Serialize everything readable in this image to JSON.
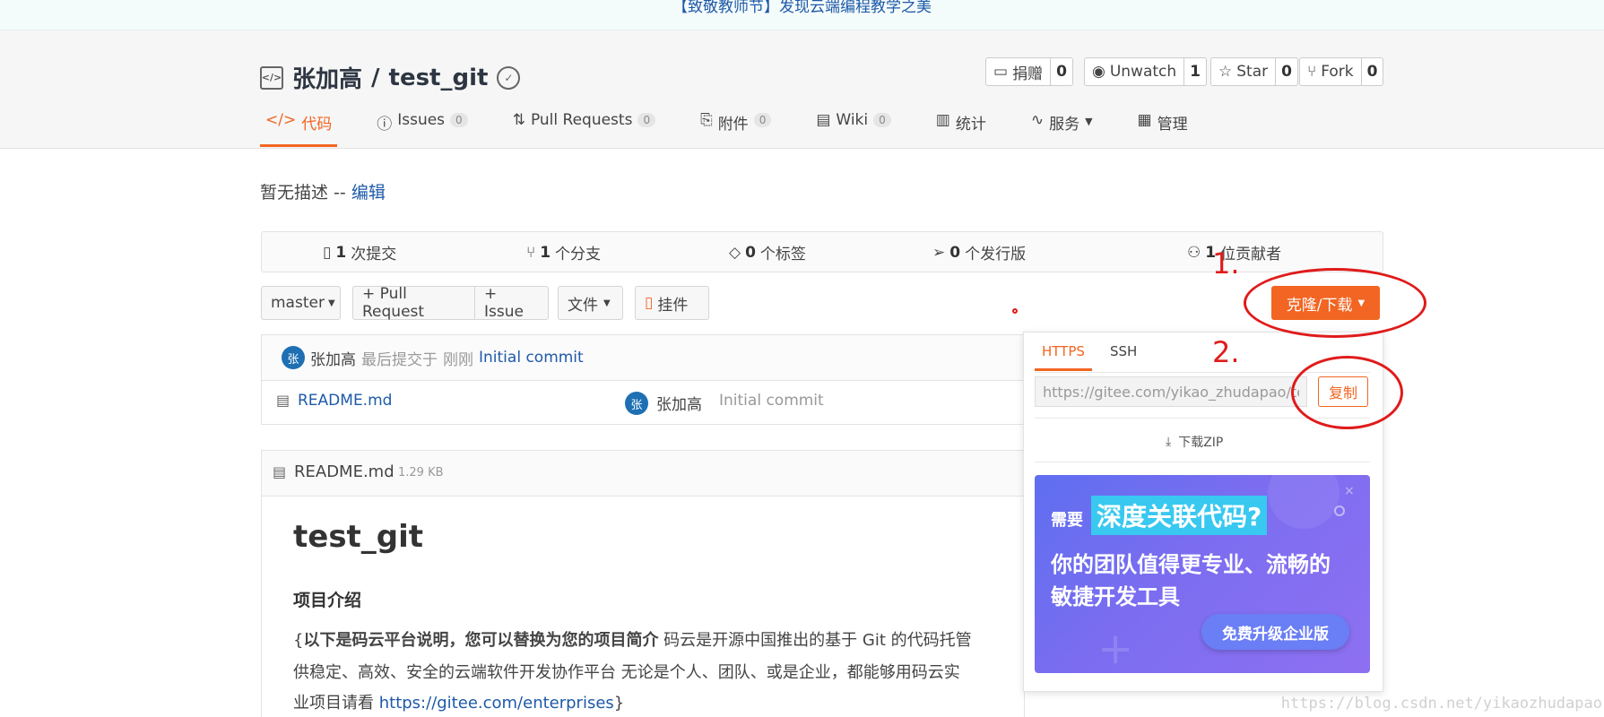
{
  "banner": {
    "text": "【致敬教师节】发现云端编程教学之美"
  },
  "repo": {
    "owner": "张加高",
    "separator": "/",
    "name": "test_git"
  },
  "actions": [
    {
      "label": "捐赠",
      "count": "0",
      "icon": "donate-icon"
    },
    {
      "label": "Unwatch",
      "count": "1",
      "icon": "eye-icon"
    },
    {
      "label": "Star",
      "count": "0",
      "icon": "star-icon"
    },
    {
      "label": "Fork",
      "count": "0",
      "icon": "fork-icon"
    }
  ],
  "tabs": [
    {
      "label": "代码",
      "icon": "code-icon"
    },
    {
      "label": "Issues",
      "count": "0",
      "icon": "issue-icon"
    },
    {
      "label": "Pull Requests",
      "count": "0",
      "icon": "pull-request-icon"
    },
    {
      "label": "附件",
      "count": "0",
      "icon": "attachment-icon"
    },
    {
      "label": "Wiki",
      "count": "0",
      "icon": "book-icon"
    },
    {
      "label": "统计",
      "icon": "chart-icon"
    },
    {
      "label": "服务",
      "icon": "pulse-icon"
    },
    {
      "label": "管理",
      "icon": "settings-doc-icon"
    }
  ],
  "description": {
    "text": "暂无描述 --",
    "edit_link": "编辑"
  },
  "stats": [
    {
      "num": "1",
      "label": "次提交"
    },
    {
      "num": "1",
      "label": "个分支"
    },
    {
      "num": "0",
      "label": "个标签"
    },
    {
      "num": "0",
      "label": "个发行版"
    },
    {
      "num": "1",
      "label": "位贡献者"
    }
  ],
  "toolbar": {
    "branch": "master",
    "pull_request": "+ Pull Request",
    "issue": "+ Issue",
    "file": "文件",
    "widget": "挂件",
    "clone": "克隆/下载"
  },
  "commit": {
    "avatar_char": "张",
    "author": "张加高",
    "meta": "最后提交于",
    "time": "刚刚",
    "message": "Initial commit"
  },
  "files": [
    {
      "name": "README.md",
      "author": "张加高",
      "avatar_char": "张",
      "message": "Initial commit"
    }
  ],
  "readme": {
    "filename": "README.md",
    "size": "1.29 KB",
    "title": "test_git",
    "section": "项目介绍",
    "line1_prefix": "{",
    "line1_bold": "以下是码云平台说明，您可以替换为您的项目简介",
    "line1_rest": " 码云是开源中国推出的基于 Git 的代码托管",
    "line2": "供稳定、高效、安全的云端软件开发协作平台 无论是个人、团队、或是企业，都能够用码云实",
    "line3_prefix": "业项目请看 ",
    "line3_link": "https://gitee.com/enterprises",
    "line3_suffix": "}"
  },
  "clone_panel": {
    "tab_https": "HTTPS",
    "tab_ssh": "SSH",
    "url": "https://gitee.com/yikao_zhudapao/test",
    "copy": "复制",
    "download": "下载ZIP",
    "promo": {
      "prefix": "需要",
      "highlight": "深度关联代码?",
      "line1": "你的团队值得更专业、流畅的",
      "line2": "敏捷开发工具",
      "button": "免费升级企业版"
    }
  },
  "annotations": {
    "step1": "1.",
    "step2": "2."
  },
  "watermark": "https://blog.csdn.net/yikaozhudapao",
  "colors": {
    "accent": "#f26522",
    "link": "#1e5aa8",
    "annotation": "#e01b1b"
  }
}
